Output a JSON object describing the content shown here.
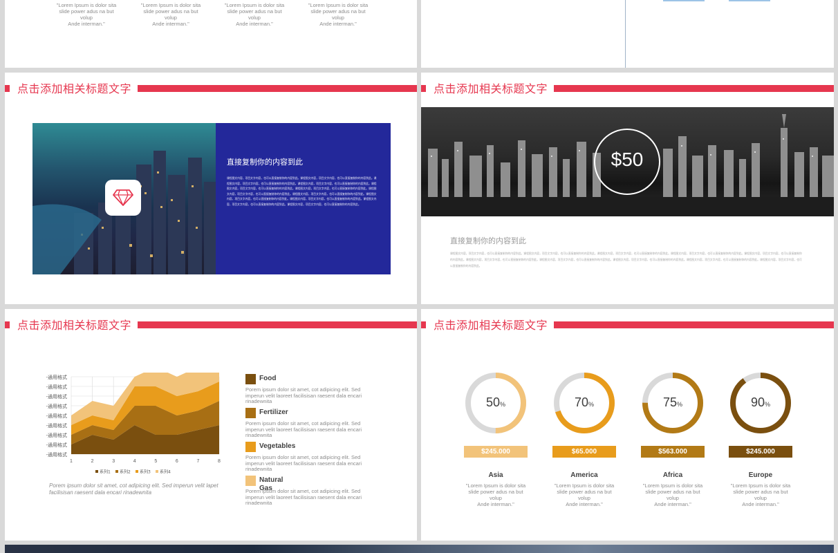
{
  "top_left": {
    "quotes": [
      [
        "\"Lorem Ipsum is dolor sita",
        "slide power adus na but",
        "volup",
        "Ande interman.\""
      ],
      [
        "\"Lorem Ipsum is dolor sita",
        "slide power adus na but",
        "volup",
        "Ande interman.\""
      ],
      [
        "\"Lorem Ipsum is dolor sita",
        "slide power adus na but",
        "volup",
        "Ande interman.\""
      ],
      [
        "\"Lorem Ipsum is dolor sita",
        "slide power adus na but",
        "volup",
        "Ande interman.\""
      ]
    ]
  },
  "slide_title": "点击添加相关标题文字",
  "city_slide": {
    "heading": "直接复制你的内容到此",
    "body": "课程图文内容，项目文字内容，也可以直接复制你的内容到此。课程图文内容，项目文字内容，也可以直接复制你的内容到此。课程图文内容，项目文字内容，也可以直接复制你的内容到此。课程图文内容，项目文字内容，也可以直接复制你的内容到此。课程图文内容，项目文字内容，也可以直接复制你的内容到此。课程图文内容，项目文字内容，也可以直接复制你的内容到此。课程图文内容，项目文字内容，也可以直接复制你的内容到此。课程图文内容，项目文字内容，也可以直接复制你的内容到此。课程图文内容，项目文字内容，也可以直接复制你的内容到此。课程图文内容，项目文字内容，也可以直接复制你的内容到此。课程图文内容，项目文字内容，也可以直接复制你的内容到此。课程图文内容，项目文字内容，也可以直接复制你的内容到此。",
    "icon": "diamond-icon"
  },
  "skyline_slide": {
    "price": "$50",
    "heading": "直接复制你的内容到此",
    "body": "课程图文内容，项目文字内容，也可以直接复制你的内容到此。课程图文内容，项目文字内容，也可以直接复制你的内容到此。课程图文内容，项目文字内容，也可以直接复制你的内容到此。课程图文内容，项目文字内容，也可以直接复制你的内容到此。课程图文内容，项目文字内容，也可以直接复制你的内容到此。课程图文内容，项目文字内容，也可以直接复制你的内容到此。课程图文内容，项目文字内容，也可以直接复制你的内容到此。课程图文内容，项目文字内容，也可以直接复制你的内容到此。课程图文内容，项目文字内容，也可以直接复制你的内容到此。课程图文内容，项目文字内容，也可以直接复制你的内容到此。"
  },
  "chart_slide": {
    "caption": "Porem ipsum dolor sit amet, cot adipicing elit. Sed imperun velit lapet facilisisan raesent dala encari rinadewnita",
    "legend": [
      {
        "label": "Food",
        "desc": "Porem ipsum dolor sit amet, cot adipicing elit. Sed imperun velit laoreet facilisisan raesent dala encari rinadewnita",
        "color": "#7a4f0f"
      },
      {
        "label": "Fertilizer",
        "desc": "Porem ipsum dolor sit amet, cot adipicing elit. Sed imperun velit laoreet facilisisan raesent dala encari rinadewnita",
        "color": "#a86f14"
      },
      {
        "label": "Vegetables",
        "desc": "Porem ipsum dolor sit amet, cot adipicing elit. Sed imperun velit laoreet facilisisan raesent dala encari rinadewnita",
        "color": "#e89c1c"
      },
      {
        "label": "Natural Gas",
        "desc": "Porem ipsum dolor sit amet, cot adipicing elit. Sed imperun velit laoreet facilisisan raesent dala encari rinadewnita",
        "color": "#f2c37a"
      }
    ]
  },
  "chart_data": {
    "type": "area",
    "x": [
      1,
      2,
      3,
      4,
      5,
      6,
      7,
      8
    ],
    "ytick_label": "-通用格式",
    "ytick_count": 8,
    "stacked": true,
    "series": [
      {
        "name": "系列1",
        "color": "#7a4f0f",
        "values": [
          1,
          2,
          1.5,
          3,
          2,
          2,
          2.5,
          3
        ]
      },
      {
        "name": "系列2",
        "color": "#a86f14",
        "values": [
          1,
          1,
          1,
          2,
          3,
          2,
          2,
          2.5
        ]
      },
      {
        "name": "系列3",
        "color": "#e89c1c",
        "values": [
          1,
          1,
          1,
          2,
          2,
          2,
          2,
          2
        ]
      },
      {
        "name": "系列4",
        "color": "#f2c37a",
        "values": [
          1,
          1.5,
          1.5,
          1,
          2,
          2,
          2.5,
          2
        ]
      }
    ],
    "ylim": [
      0,
      8
    ],
    "grid": true,
    "legend_position": "bottom"
  },
  "rings_slide": {
    "items": [
      {
        "pct": 50,
        "pct_text": "50",
        "unit": "%",
        "money": "$245.000",
        "region": "Asia",
        "color": "#f2c37a",
        "quote": [
          "\"Lorem Ipsum is dolor sita",
          "slide power adus na but",
          "volup",
          "Ande interman.\""
        ]
      },
      {
        "pct": 70,
        "pct_text": "70",
        "unit": "%",
        "money": "$65.000",
        "region": "America",
        "color": "#e89c1c",
        "quote": [
          "\"Lorem Ipsum is dolor sita",
          "slide power adus na but",
          "volup",
          "Ande interman.\""
        ]
      },
      {
        "pct": 75,
        "pct_text": "75",
        "unit": "%",
        "money": "$563.000",
        "region": "Africa",
        "color": "#b27a16",
        "quote": [
          "\"Lorem Ipsum is dolor sita",
          "slide power adus na but",
          "volup",
          "Ande interman.\""
        ]
      },
      {
        "pct": 90,
        "pct_text": "90",
        "unit": "%",
        "money": "$245.000",
        "region": "Europe",
        "color": "#7a4f0f",
        "quote": [
          "\"Lorem Ipsum is dolor sita",
          "slide power adus na but",
          "volup",
          "Ande interman.\""
        ]
      }
    ]
  }
}
